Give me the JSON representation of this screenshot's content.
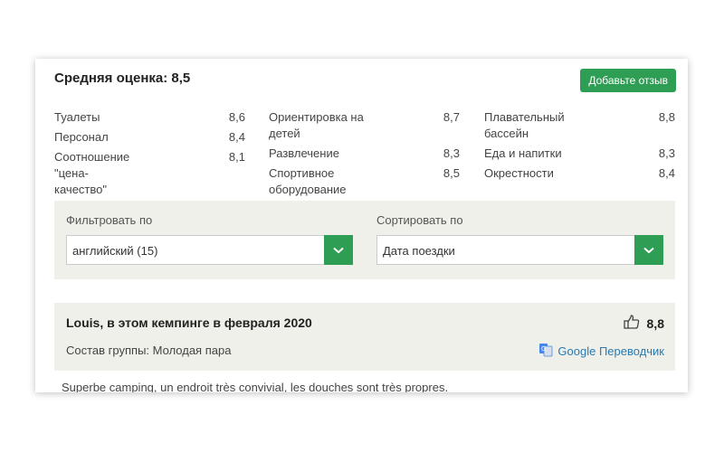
{
  "header": {
    "average_label": "Средняя оценка: 8,5",
    "add_review_button": "Добавьте отзыв"
  },
  "ratings": {
    "col1": [
      {
        "label": "Туалеты",
        "value": "8,6"
      },
      {
        "label": "Персонал",
        "value": "8,4"
      },
      {
        "label": "Соотношение \"цена-качество\"",
        "value": "8,1"
      }
    ],
    "col2": [
      {
        "label": "Ориентировка на детей",
        "value": "8,7"
      },
      {
        "label": "Развлечение",
        "value": "8,3"
      },
      {
        "label": "Спортивное оборудование",
        "value": "8,5"
      }
    ],
    "col3": [
      {
        "label": "Плавательный бассейн",
        "value": "8,8"
      },
      {
        "label": "Еда и напитки",
        "value": "8,3"
      },
      {
        "label": "Окрестности",
        "value": "8,4"
      }
    ]
  },
  "filters": {
    "filter_label": "Фильтровать по",
    "filter_value": "английский (15)",
    "sort_label": "Сортировать по",
    "sort_value": "Дата поездки"
  },
  "review": {
    "title": "Louis, в этом кемпинге в февраля 2020",
    "score": "8,8",
    "group": "Состав группы: Молодая пара",
    "translator": "Google Переводчик",
    "text": "Superbe camping, un endroit très convivial, les douches sont très propres."
  },
  "colors": {
    "accent": "#2e9e54",
    "panel": "#f0f0ea",
    "link": "#2a7ab0"
  }
}
